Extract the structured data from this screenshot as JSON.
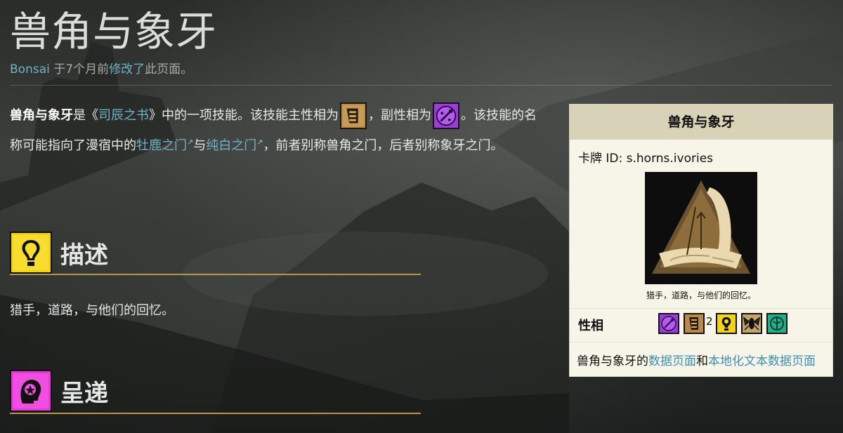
{
  "page": {
    "title": "兽角与象牙",
    "byline": {
      "user": "Bonsai",
      "before": " 于7个月前",
      "edit_link": "修改了",
      "after": "此页面。"
    }
  },
  "intro": {
    "bold_name": "兽角与象牙",
    "t1": "是《",
    "book_link": "司辰之书",
    "t2": "》中的一项技能。该技能主性相为",
    "t3": "，副性相为",
    "t4": "。该技能的名称可能指向了漫宿中的",
    "gate1": "牡鹿之门",
    "t5": "与",
    "gate2": "纯白之门",
    "t6": "，前者别称兽角之门，后者别称象牙之门。",
    "primary_aspect_icon": "forge-aspect-icon",
    "secondary_aspect_icon": "knock-aspect-icon"
  },
  "sections": [
    {
      "title": "描述",
      "icon": "lantern-aspect-icon",
      "text": "猎手，道路，与他们的回忆。"
    },
    {
      "title": "呈递",
      "icon": "heart-aspect-icon"
    }
  ],
  "infobox": {
    "title": "兽角与象牙",
    "card_id_label": "卡牌 ID: s.horns.ivories",
    "caption": "猎手，道路，与他们的回忆。",
    "aspects_label": "性相",
    "aspects": [
      {
        "icon": "knock-aspect-icon",
        "count": ""
      },
      {
        "icon": "forge-aspect-icon",
        "count": "2"
      },
      {
        "icon": "lantern-aspect-icon",
        "count": ""
      },
      {
        "icon": "moth-aspect-icon",
        "count": ""
      },
      {
        "icon": "grail-aspect-icon",
        "count": ""
      }
    ],
    "footer": {
      "t1": "兽角与象牙的",
      "link1": "数据页面",
      "t2": "和",
      "link2": "本地化文本数据页面"
    }
  },
  "colors": {
    "link": "#6fb3c7",
    "section_rule": "#b9964f",
    "infobox_bg": "#f6f5e8",
    "infobox_header": "#d8d2b8"
  }
}
